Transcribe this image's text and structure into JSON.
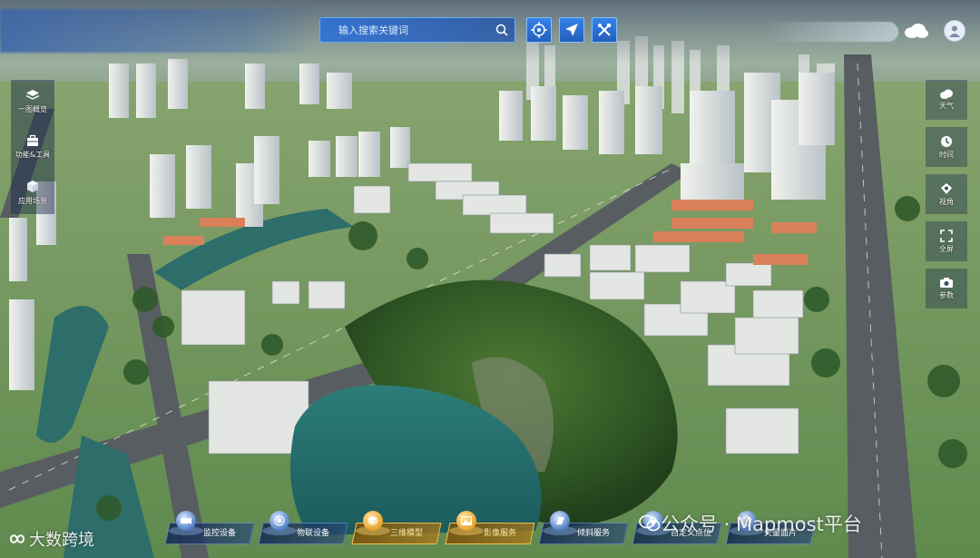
{
  "search": {
    "placeholder": "输入搜索关键词"
  },
  "toolbar": {
    "buttons": [
      {
        "name": "locate",
        "icon": "target-icon"
      },
      {
        "name": "navigate",
        "icon": "send-arrow-icon"
      },
      {
        "name": "tools",
        "icon": "crossed-tools-icon"
      }
    ]
  },
  "left_menu": [
    {
      "label": "一图概览",
      "icon": "layers-icon"
    },
    {
      "label": "功能&工具",
      "icon": "toolbox-icon"
    },
    {
      "label": "应用场景",
      "icon": "cube-icon"
    }
  ],
  "right_menu": [
    {
      "label": "天气",
      "icon": "cloud-icon"
    },
    {
      "label": "时间",
      "icon": "clock-icon"
    },
    {
      "label": "视角",
      "icon": "eye-icon"
    },
    {
      "label": "全屏",
      "icon": "fullscreen-icon"
    },
    {
      "label": "参数",
      "icon": "camera-icon"
    }
  ],
  "bottom_nav": [
    {
      "label": "监控设备",
      "icon": "camera-icon",
      "active": false
    },
    {
      "label": "物联设备",
      "icon": "iot-icon",
      "active": false
    },
    {
      "label": "三维模型",
      "icon": "model-icon",
      "active": true
    },
    {
      "label": "影像服务",
      "icon": "image-icon",
      "active": true
    },
    {
      "label": "倾斜服务",
      "icon": "tilt-icon",
      "active": false
    },
    {
      "label": "自定义点位",
      "icon": "pin-icon",
      "active": false
    },
    {
      "label": "矢量面片",
      "icon": "polygon-icon",
      "active": false
    }
  ],
  "watermarks": {
    "left": "大数跨境",
    "right": "公众号 · Mapmost平台"
  },
  "colors": {
    "panel_blue": "#2a6fd6",
    "active_gold": "#e7a22a",
    "water": "#1f6b6a",
    "vegetation": "#2f5a2a"
  }
}
